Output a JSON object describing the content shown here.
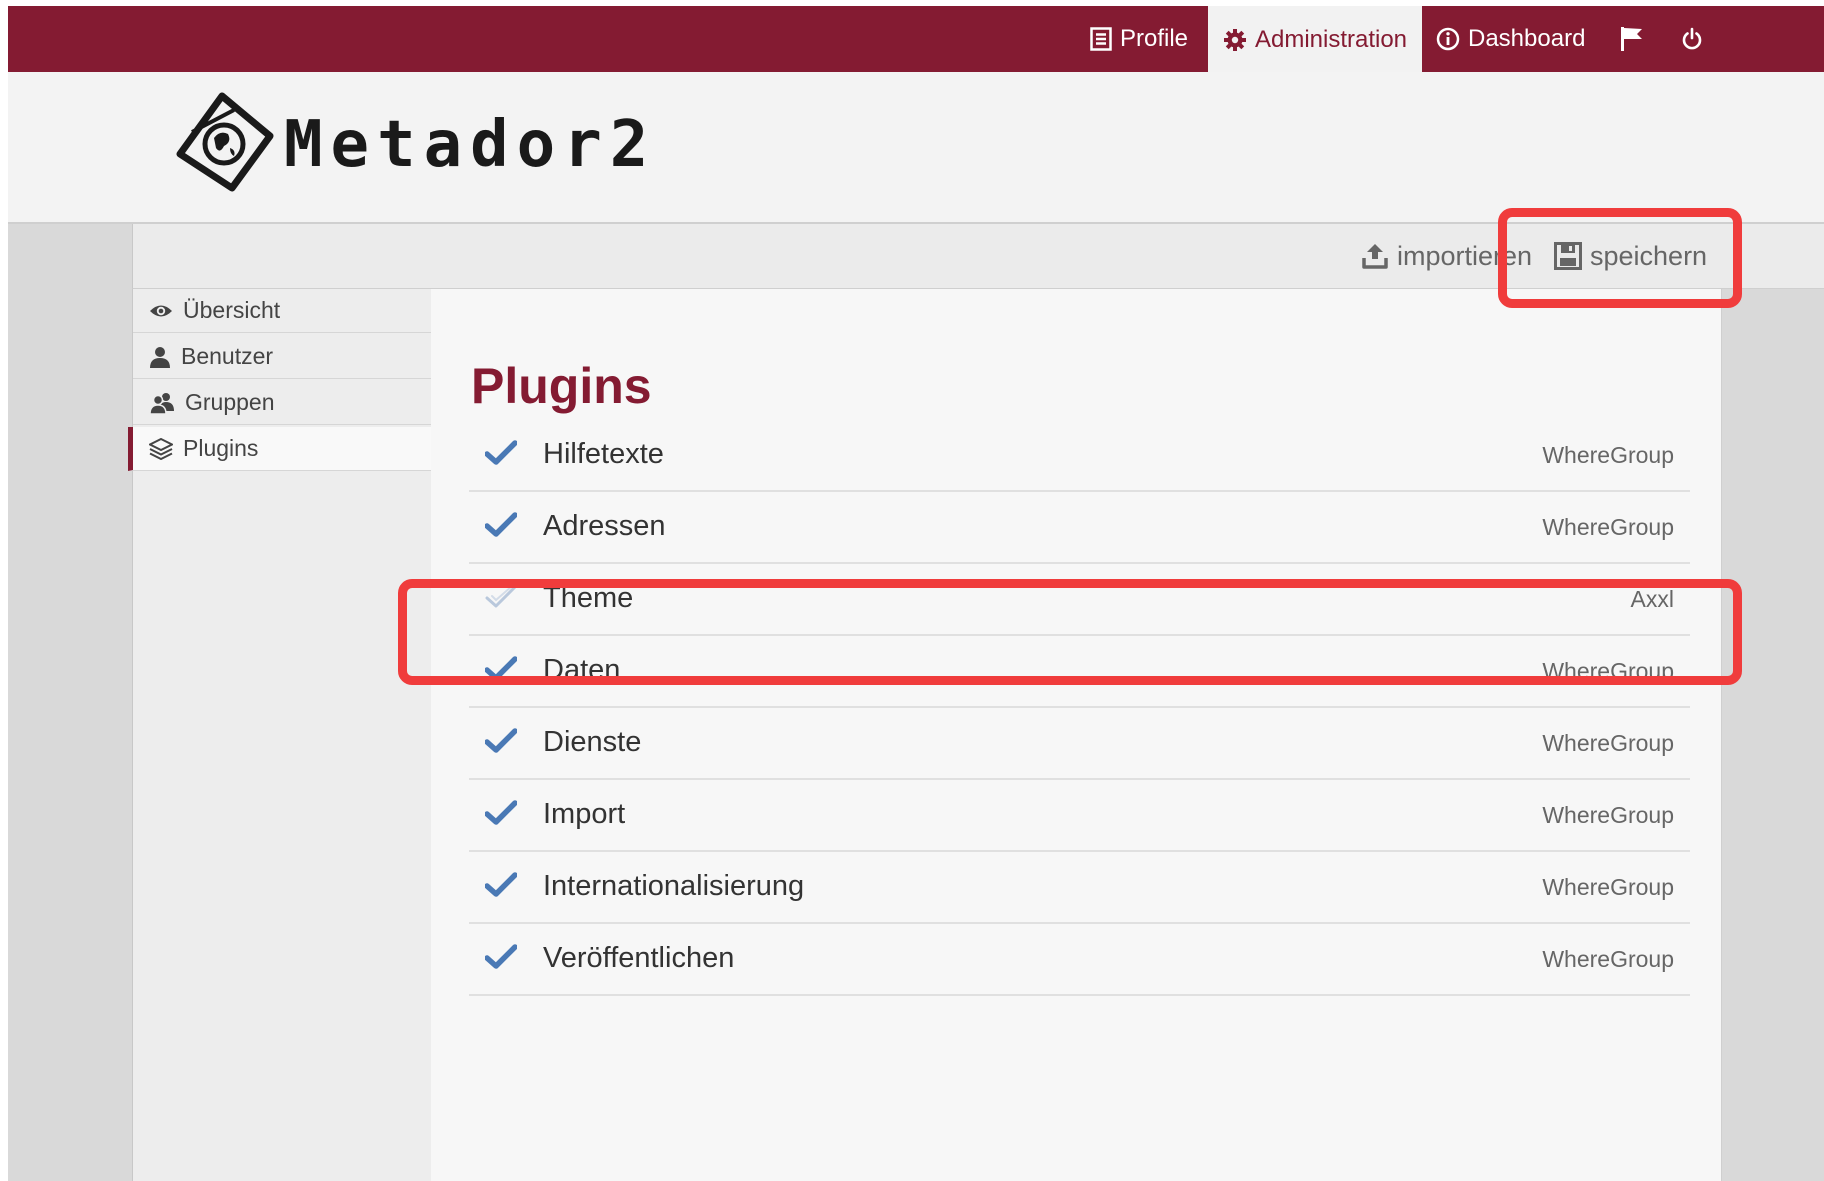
{
  "topnav": {
    "profile_label": "Profile",
    "administration_label": "Administration",
    "dashboard_label": "Dashboard"
  },
  "brand": {
    "name": "Metador2"
  },
  "toolbar": {
    "import_label": "importieren",
    "save_label": "speichern"
  },
  "sidebar": {
    "items": [
      {
        "label": "Übersicht",
        "icon": "eye-icon"
      },
      {
        "label": "Benutzer",
        "icon": "user-icon"
      },
      {
        "label": "Gruppen",
        "icon": "users-icon"
      },
      {
        "label": "Plugins",
        "icon": "layers-icon",
        "active": true
      }
    ]
  },
  "main": {
    "title": "Plugins",
    "plugins": [
      {
        "name": "Hilfetexte",
        "vendor": "WhereGroup",
        "enabled": true
      },
      {
        "name": "Adressen",
        "vendor": "WhereGroup",
        "enabled": true
      },
      {
        "name": "Theme",
        "vendor": "Axxl",
        "enabled": false
      },
      {
        "name": "Daten",
        "vendor": "WhereGroup",
        "enabled": true
      },
      {
        "name": "Dienste",
        "vendor": "WhereGroup",
        "enabled": true
      },
      {
        "name": "Import",
        "vendor": "WhereGroup",
        "enabled": true
      },
      {
        "name": "Internationalisierung",
        "vendor": "WhereGroup",
        "enabled": true
      },
      {
        "name": "Veröffentlichen",
        "vendor": "WhereGroup",
        "enabled": true
      }
    ]
  },
  "colors": {
    "brand": "#841b32",
    "check_enabled": "#4a79b5",
    "check_disabled": "#b9c8dc",
    "highlight": "#f03c3c"
  }
}
